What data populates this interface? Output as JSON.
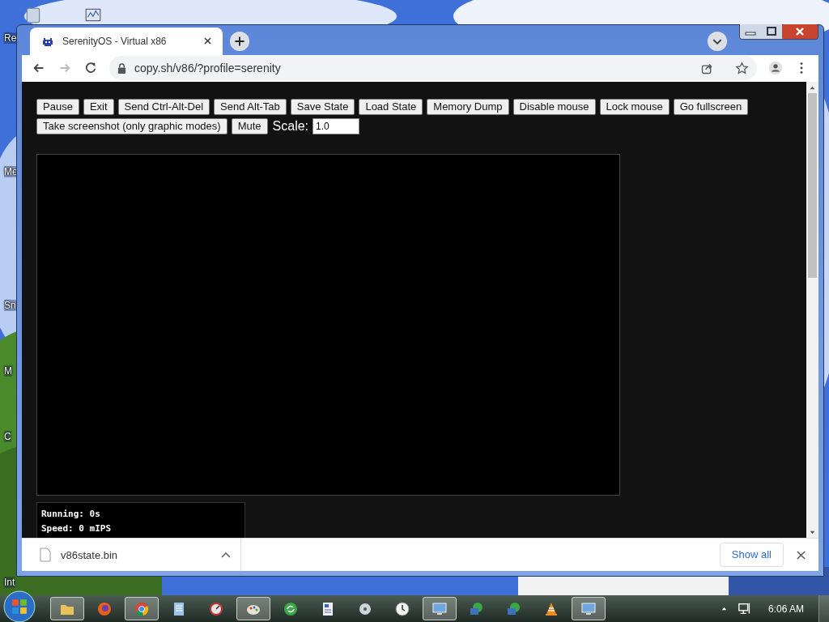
{
  "desktop": {
    "icon_labels": [
      "Re",
      "Me",
      "Sn",
      "M",
      "C",
      "Int"
    ]
  },
  "browser": {
    "tabs": [
      {
        "title": "SerenityOS - Virtual x86",
        "selected": true
      }
    ],
    "address": "copy.sh/v86/?profile=serenity"
  },
  "page": {
    "buttons": [
      "Pause",
      "Exit",
      "Send Ctrl-Alt-Del",
      "Send Alt-Tab",
      "Save State",
      "Load State",
      "Memory Dump",
      "Disable mouse",
      "Lock mouse",
      "Go fullscreen",
      "Take screenshot (only graphic modes)",
      "Mute"
    ],
    "scale": {
      "label": "Scale:",
      "value": "1.0"
    },
    "stats": [
      "Running: 0s",
      "Speed: 0 mIPS"
    ]
  },
  "download_bar": {
    "items": [
      {
        "file": "v86state.bin"
      }
    ],
    "show_all": "Show all"
  },
  "taskbar": {
    "apps": [
      {
        "kind": "folder",
        "open": true
      },
      {
        "kind": "fox",
        "open": false
      },
      {
        "kind": "chrome",
        "open": true
      },
      {
        "kind": "notepad",
        "open": false
      },
      {
        "kind": "gauge",
        "open": false
      },
      {
        "kind": "paint",
        "open": true
      },
      {
        "kind": "refresh",
        "open": false
      },
      {
        "kind": "document",
        "open": false
      },
      {
        "kind": "disc",
        "open": false
      },
      {
        "kind": "clock",
        "open": false
      },
      {
        "kind": "monitor",
        "open": true
      },
      {
        "kind": "network",
        "open": false
      },
      {
        "kind": "network",
        "open": false
      },
      {
        "kind": "cone",
        "open": false
      },
      {
        "kind": "monitor",
        "open": true
      }
    ],
    "clock": "6:06 AM"
  }
}
